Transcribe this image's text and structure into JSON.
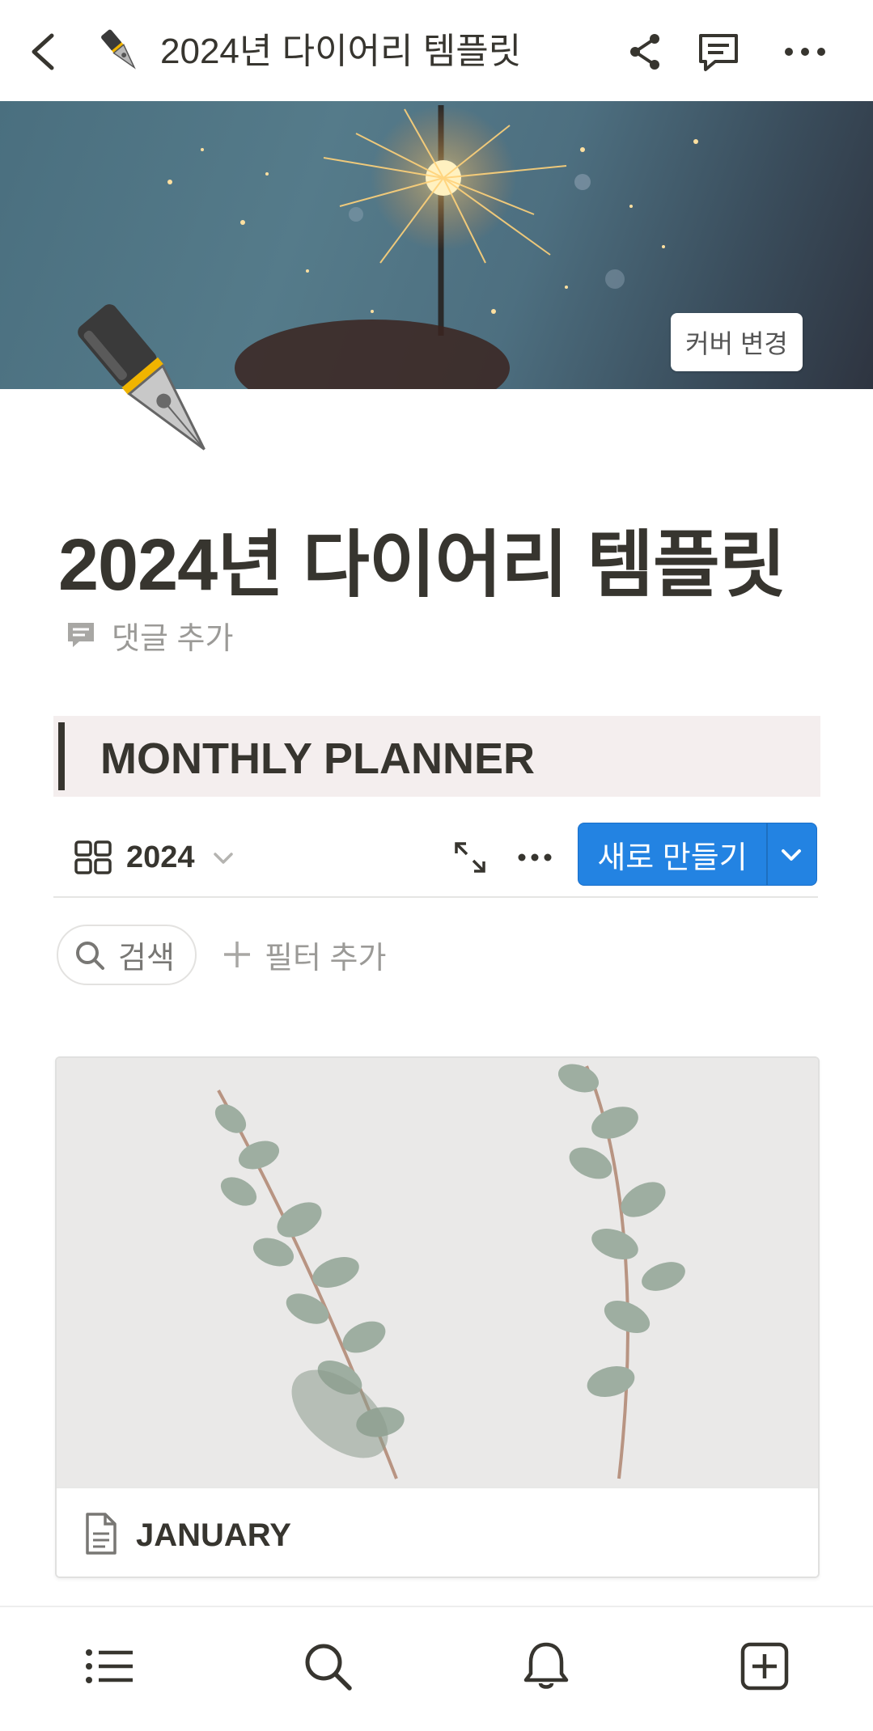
{
  "topbar": {
    "title": "2024년 다이어리 템플릿",
    "page_icon": "fountain-pen-emoji",
    "actions": [
      "back-icon",
      "share-icon",
      "comment-icon",
      "more-icon"
    ]
  },
  "cover": {
    "change_cover_label": "커버 변경"
  },
  "page": {
    "title": "2024년 다이어리 템플릿",
    "add_comment_label": "댓글 추가"
  },
  "callout": {
    "text": "MONTHLY PLANNER"
  },
  "database": {
    "view_name": "2024",
    "new_button_label": "새로 만들기",
    "search_label": "검색",
    "filter_label": "필터 추가"
  },
  "gallery": {
    "cards": [
      {
        "title": "JANUARY"
      }
    ]
  },
  "bottomnav": {
    "items": [
      "list-icon",
      "search-icon",
      "bell-icon",
      "new-page-icon"
    ]
  },
  "colors": {
    "accent": "#2383e2",
    "text": "#37352f",
    "callout_bg": "#f4eeee"
  }
}
